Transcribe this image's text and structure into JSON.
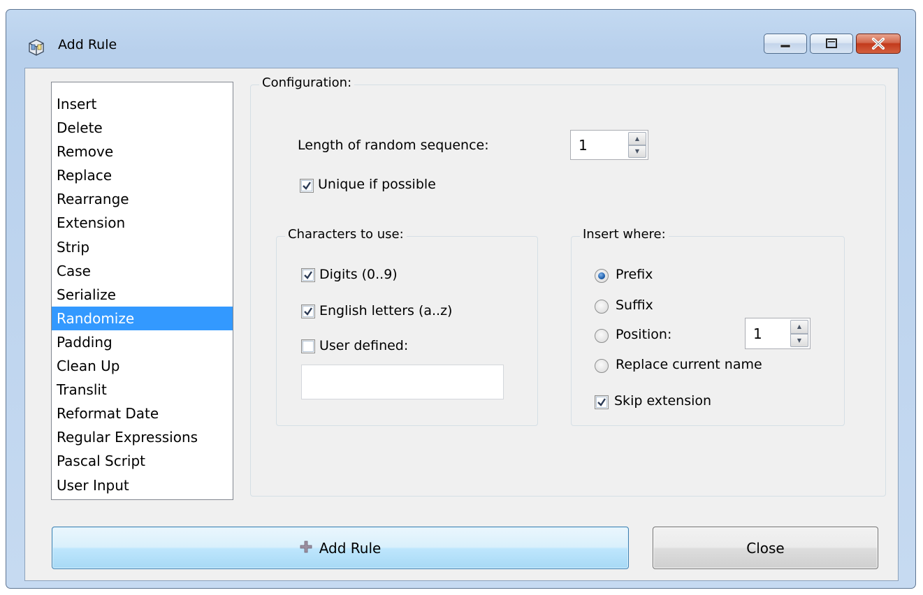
{
  "window": {
    "title": "Add Rule",
    "icon": "app-icon"
  },
  "title_buttons": {
    "minimize": "minimize-icon",
    "maximize": "maximize-icon",
    "close": "close-icon"
  },
  "rules": {
    "selected": "Randomize",
    "items": [
      "Insert",
      "Delete",
      "Remove",
      "Replace",
      "Rearrange",
      "Extension",
      "Strip",
      "Case",
      "Serialize",
      "Randomize",
      "Padding",
      "Clean Up",
      "Translit",
      "Reformat Date",
      "Regular Expressions",
      "Pascal Script",
      "User Input"
    ]
  },
  "config": {
    "caption": "Configuration:",
    "length_label": "Length of random sequence:",
    "length_value": "1",
    "unique_label": "Unique if possible",
    "unique_checked": true,
    "chars": {
      "caption": "Characters to use:",
      "digits_label": "Digits (0..9)",
      "digits_checked": true,
      "letters_label": "English letters (a..z)",
      "letters_checked": true,
      "user_label": "User defined:",
      "user_checked": false,
      "user_value": ""
    },
    "where": {
      "caption": "Insert where:",
      "prefix_label": "Prefix",
      "suffix_label": "Suffix",
      "position_label": "Position:",
      "position_value": "1",
      "replace_label": "Replace current name",
      "selected": "Prefix",
      "skip_ext_label": "Skip extension",
      "skip_ext_checked": true
    }
  },
  "buttons": {
    "add_rule": "Add Rule",
    "add_icon": "plus-icon",
    "close": "Close"
  },
  "colors": {
    "selection": "#3399ff",
    "add_button": "#bee6fd"
  }
}
